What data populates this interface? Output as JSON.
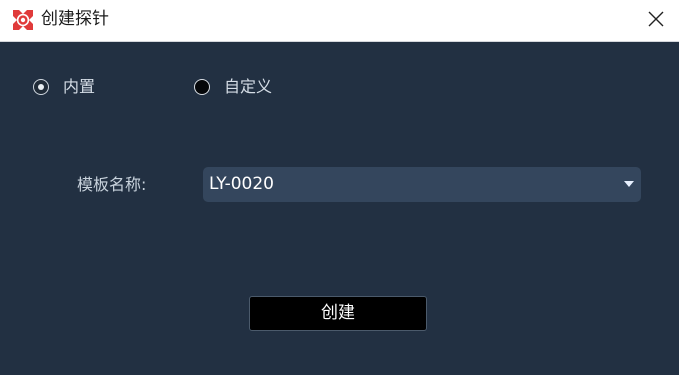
{
  "window": {
    "title": "创建探针",
    "close_icon": "close-icon"
  },
  "probe_type": {
    "options": [
      {
        "label": "内置",
        "checked": true
      },
      {
        "label": "自定义",
        "checked": false
      }
    ]
  },
  "template": {
    "label": "模板名称:",
    "selected": "LY-0020"
  },
  "actions": {
    "create_label": "创建"
  },
  "colors": {
    "background": "#223042",
    "select_background": "#34465d",
    "button_background": "#000000",
    "titlebar": "#ffffff",
    "icon_red": "#e03a3a"
  }
}
